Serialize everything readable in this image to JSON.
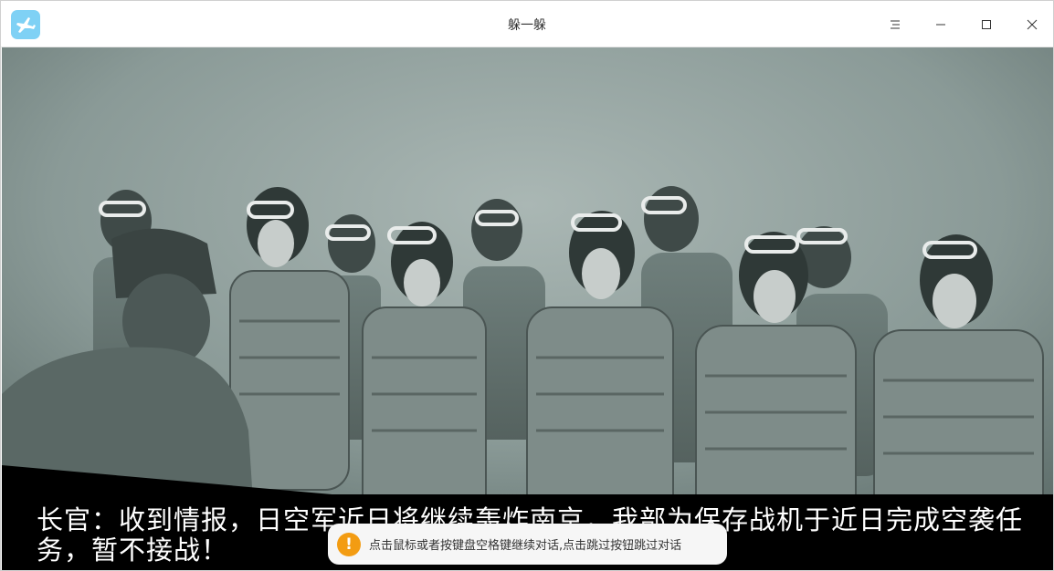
{
  "window": {
    "title": "躲一躲",
    "app_icon": "plane-icon",
    "controls": {
      "menu_icon": "menu-icon",
      "minimize_icon": "minimize-icon",
      "maximize_icon": "maximize-icon",
      "close_icon": "close-icon"
    }
  },
  "scene": {
    "image": "black-and-white photo of pilots in flight helmets and goggles lined up before an officer",
    "dialog": "长官：收到情报，日空军近日将继续轰炸南京，我部为保存战机于近日完成空袭任务，暂不接战！"
  },
  "toast": {
    "icon": "warning-icon",
    "accent": "#f39c12",
    "text": "点击鼠标或者按键盘空格键继续对话,点击跳过按钮跳过对话"
  }
}
